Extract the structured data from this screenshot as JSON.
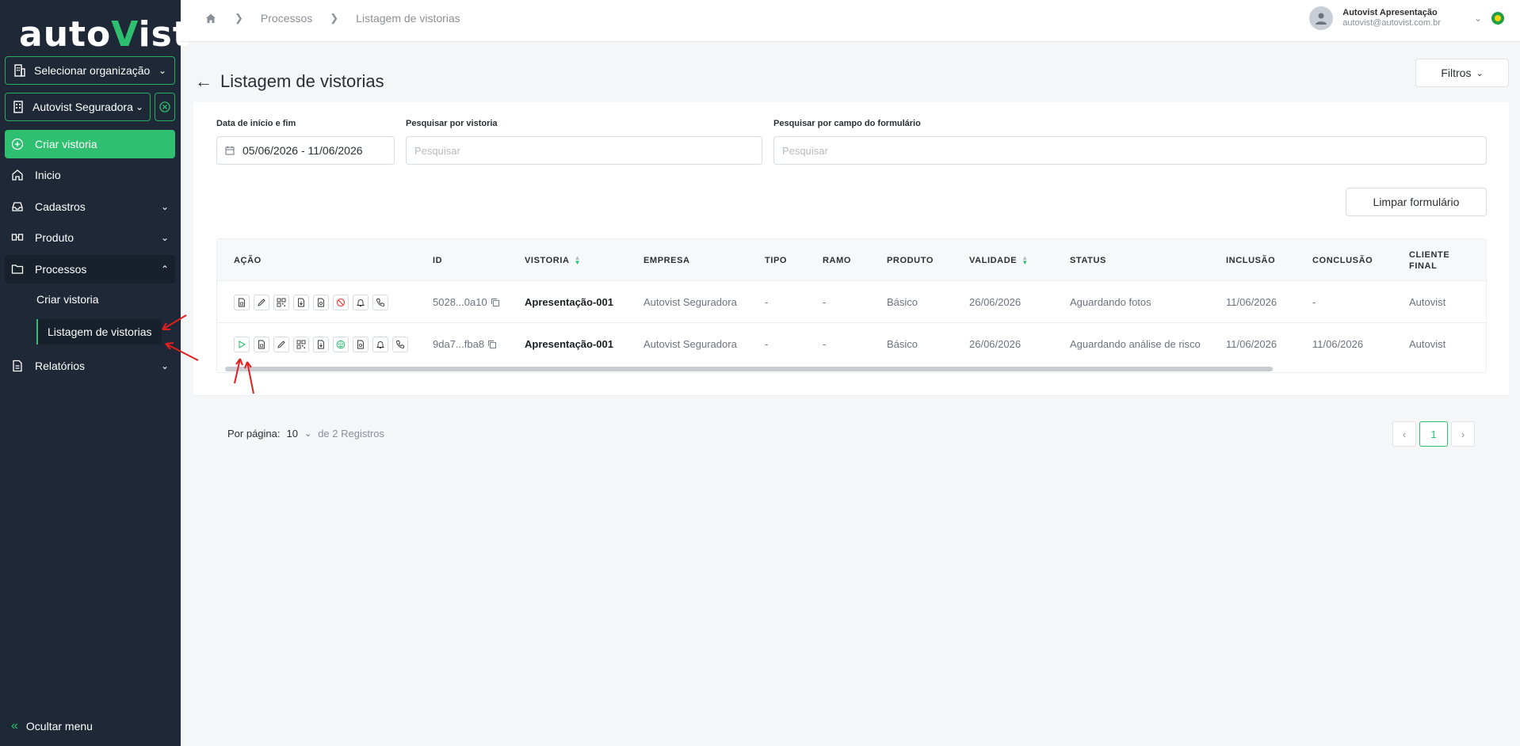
{
  "sidebar": {
    "logo_prefix": "auto",
    "logo_v": "V",
    "logo_suffix": "ist",
    "org_select_label": "Selecionar organização",
    "current_org_label": "Autovist Seguradora",
    "create_inspection_label": "Criar vistoria",
    "items": [
      {
        "label": "Inicio"
      },
      {
        "label": "Cadastros"
      },
      {
        "label": "Produto"
      },
      {
        "label": "Processos"
      },
      {
        "label": "Relatórios"
      }
    ],
    "sub_items": [
      {
        "label": "Criar vistoria"
      },
      {
        "label": "Listagem de vistorias"
      }
    ],
    "hide_menu_label": "Ocultar menu",
    "accent_color": "#2fbf71",
    "background_color": "#1f2836"
  },
  "topbar": {
    "breadcrumb": [
      "Processos",
      "Listagem de vistorias"
    ],
    "user_name": "Autovist Apresentação",
    "user_email": "autovist@autovist.com.br"
  },
  "page": {
    "title": "Listagem de vistorias",
    "filters_label": "Filtros"
  },
  "form": {
    "date_label": "Data de início e fim",
    "date_value": "05/06/2026 - 11/06/2026",
    "search_inspection_label": "Pesquisar por vistoria",
    "search_inspection_placeholder": "Pesquisar",
    "search_field_label": "Pesquisar por campo do formulário",
    "search_field_placeholder": "Pesquisar",
    "clear_label": "Limpar formulário"
  },
  "table": {
    "columns": [
      "AÇÃO",
      "ID",
      "VISTORIA",
      "EMPRESA",
      "TIPO",
      "RAMO",
      "PRODUTO",
      "VALIDADE",
      "STATUS",
      "INCLUSÃO",
      "CONCLUSÃO",
      "CLIENTE FINAL"
    ],
    "rows": [
      {
        "actions": [
          "document-icon",
          "edit-icon",
          "qrcode-icon",
          "download-icon",
          "pdf-icon",
          "block-icon",
          "bell-icon",
          "phone-icon"
        ],
        "id": "5028...0a10",
        "vistoria": "Apresentação-001",
        "empresa": "Autovist Seguradora",
        "tipo": "-",
        "ramo": "-",
        "produto": "Básico",
        "validade": "26/06/2026",
        "status": "Aguardando fotos",
        "inclusao": "11/06/2026",
        "conclusao": "-",
        "cliente_final": "Autovist"
      },
      {
        "actions": [
          "play-icon",
          "document-icon",
          "edit-icon",
          "qrcode-icon",
          "download-icon",
          "brain-icon",
          "pdf-icon",
          "bell-icon",
          "phone-icon"
        ],
        "id": "9da7...fba8",
        "vistoria": "Apresentação-001",
        "empresa": "Autovist Seguradora",
        "tipo": "-",
        "ramo": "-",
        "produto": "Básico",
        "validade": "26/06/2026",
        "status": "Aguardando análise de risco",
        "inclusao": "11/06/2026",
        "conclusao": "11/06/2026",
        "cliente_final": "Autovist"
      }
    ],
    "horizontal_scroll_fraction": 0.83
  },
  "pagination": {
    "per_page_label": "Por página:",
    "per_page_value": "10",
    "total_label": "de 2 Registros",
    "current_page": "1"
  }
}
